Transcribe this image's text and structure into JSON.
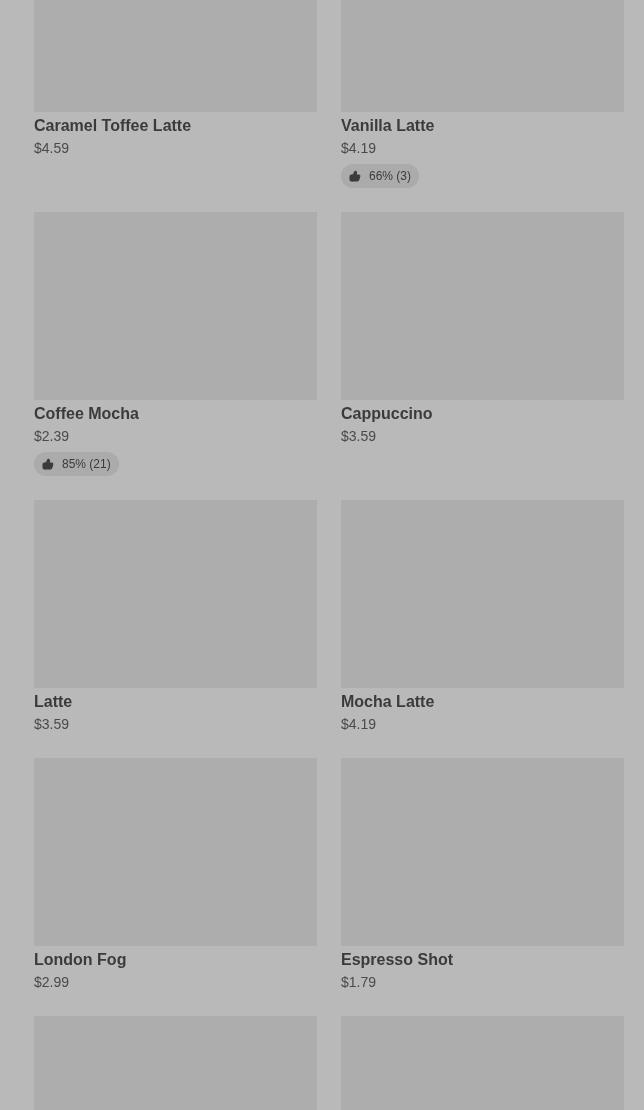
{
  "products": [
    {
      "kind": "card",
      "name": "Caramel Toffee Latte",
      "price": "$4.59"
    },
    {
      "kind": "card",
      "name": "Vanilla Latte",
      "price": "$4.19",
      "rating": "66% (3)"
    },
    {
      "kind": "card",
      "name": "Coffee Mocha",
      "price": "$2.39",
      "rating": "85% (21)"
    },
    {
      "kind": "card",
      "name": "Cappuccino",
      "price": "$3.59"
    },
    {
      "kind": "card",
      "name": "Latte",
      "price": "$3.59"
    },
    {
      "kind": "card",
      "name": "Mocha Latte",
      "price": "$4.19"
    },
    {
      "kind": "card",
      "name": "London Fog",
      "price": "$2.99"
    },
    {
      "kind": "card",
      "name": "Espresso Shot",
      "price": "$1.79"
    },
    {
      "kind": "image"
    },
    {
      "kind": "image"
    }
  ]
}
